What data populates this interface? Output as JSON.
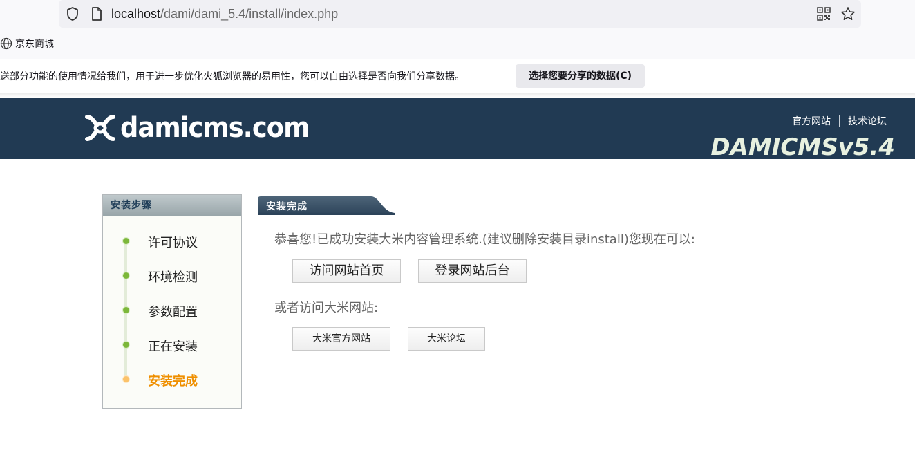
{
  "browser": {
    "url_host": "localhost",
    "url_path": "/dami/dami_5.4/install/index.php",
    "bookmark_label": "京东商城",
    "notification_text": "送部分功能的使用情况给我们，用于进一步优化火狐浏览器的易用性，您可以自由选择是否向我们分享数据。",
    "notification_button": "选择您要分享的数据(C)"
  },
  "header": {
    "logo_text": "damicms.com",
    "links": [
      "官方网站",
      "技术论坛"
    ],
    "version": "DAMICMSv5.4"
  },
  "steps": {
    "title": "安装步骤",
    "items": [
      {
        "label": "许可协议",
        "state": "done"
      },
      {
        "label": "环境检测",
        "state": "done"
      },
      {
        "label": "参数配置",
        "state": "done"
      },
      {
        "label": "正在安装",
        "state": "done"
      },
      {
        "label": "安装完成",
        "state": "active"
      }
    ]
  },
  "main": {
    "tab_title": "安装完成",
    "congrats_text": "恭喜您!已成功安装大米内容管理系统.(建议删除安装目录install)您现在可以:",
    "visit_home_button": "访问网站首页",
    "login_admin_button": "登录网站后台",
    "or_visit_text": "或者访问大米网站:",
    "official_site_button": "大米官方网站",
    "forum_button": "大米论坛"
  },
  "colors": {
    "header_bg": "#213a53",
    "step_done": "#7cb73a",
    "step_active": "#ef8f00"
  }
}
